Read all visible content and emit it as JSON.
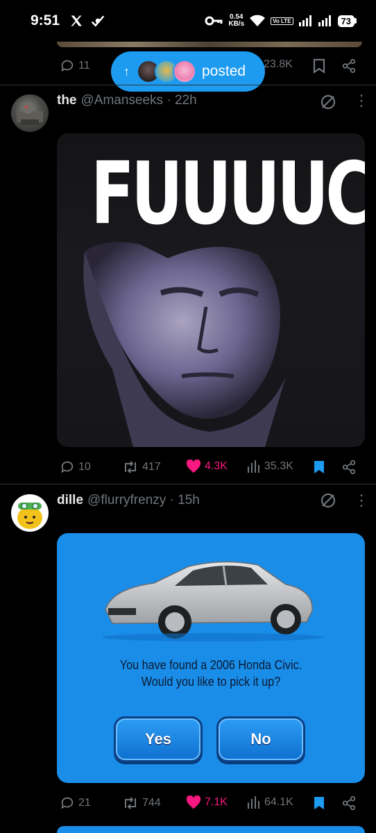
{
  "status_bar": {
    "time": "9:51",
    "speed_value": "0.54",
    "speed_unit": "KB/s",
    "volte": "Vo LTE",
    "battery": "73"
  },
  "prev_tweet": {
    "replies": "11",
    "views": "23.8K"
  },
  "posted_pill": {
    "label": "posted"
  },
  "tweets": [
    {
      "name": "the",
      "handle": "@Amanseeks",
      "time": "22h",
      "meme_text": "FUUUUCK",
      "replies": "10",
      "retweets": "417",
      "likes": "4.3K",
      "views": "35.3K"
    },
    {
      "name": "dille",
      "handle": "@flurryfrenzy",
      "time": "15h",
      "dialog_line1": "You have found a 2006 Honda Civic.",
      "dialog_line2": "Would you like to pick it up?",
      "yes_label": "Yes",
      "no_label": "No",
      "replies": "21",
      "retweets": "744",
      "likes": "7.1K",
      "views": "64.1K"
    }
  ],
  "colors": {
    "accent": "#1d9bf0",
    "like": "#f91880",
    "muted": "#71767b"
  }
}
